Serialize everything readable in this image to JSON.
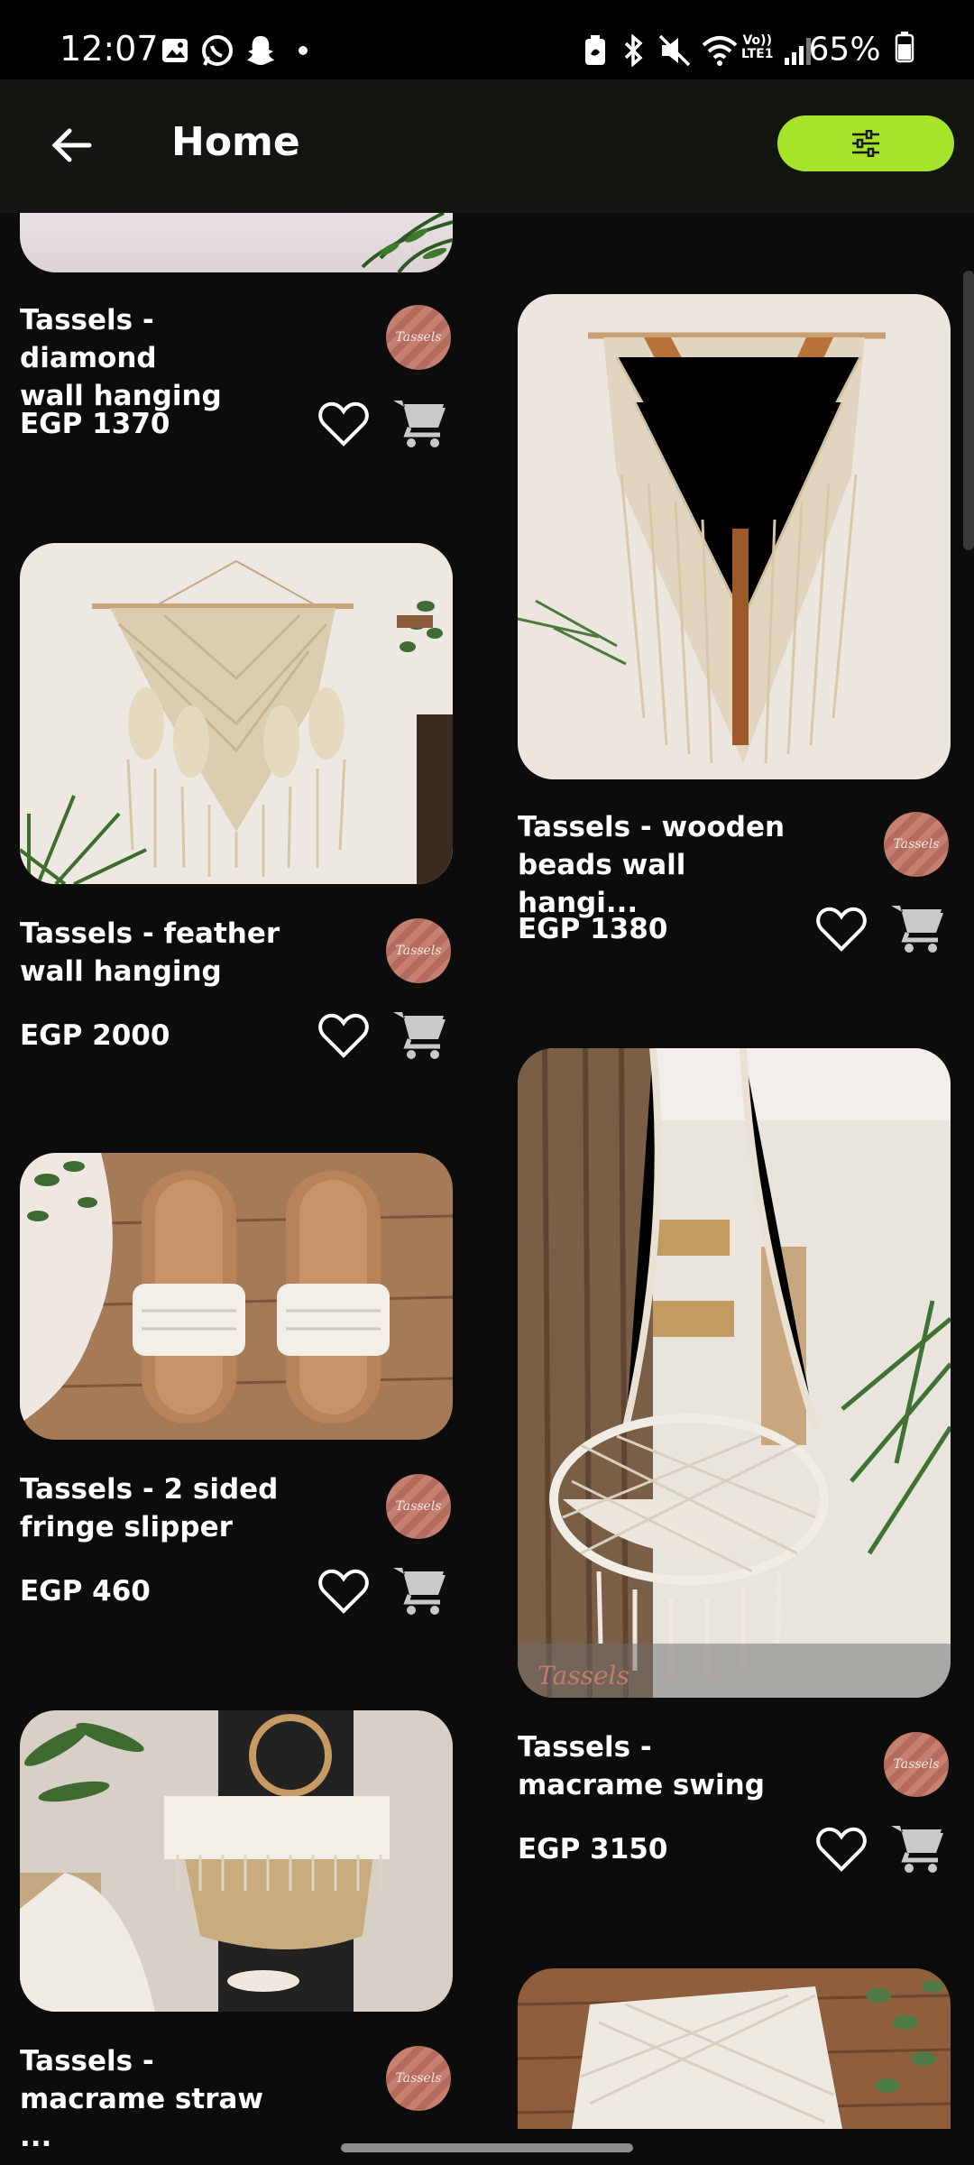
{
  "status": {
    "time": "12:07",
    "battery": "65%",
    "icons": [
      "gallery-icon",
      "whatsapp-icon",
      "snapchat-icon",
      "dot-icon",
      "battery-saver-icon",
      "bluetooth-icon",
      "mute-icon",
      "wifi-icon",
      "volte-icon",
      "signal-icon",
      "battery-icon"
    ]
  },
  "header": {
    "title": "Home",
    "back_icon": "arrow-left-icon",
    "filter_icon": "sliders-icon"
  },
  "colors": {
    "accent": "#a6e32a",
    "background": "#0c0c0c",
    "appbar": "#131511"
  },
  "brand_logo_text": "Tassels",
  "products": [
    {
      "name": "Tassels - diamond\nwall hanging",
      "price": "EGP 1370"
    },
    {
      "name": "Tassels - wooden\nbeads wall hangi...",
      "price": "EGP 1380"
    },
    {
      "name": "Tassels - feather\nwall hanging",
      "price": "EGP 2000"
    },
    {
      "name": "Tassels - 2 sided\nfringe slipper",
      "price": "EGP 460"
    },
    {
      "name": "Tassels -\nmacrame swing",
      "price": "EGP 3150"
    },
    {
      "name": "Tassels -\nmacrame straw ...",
      "price": ""
    }
  ]
}
